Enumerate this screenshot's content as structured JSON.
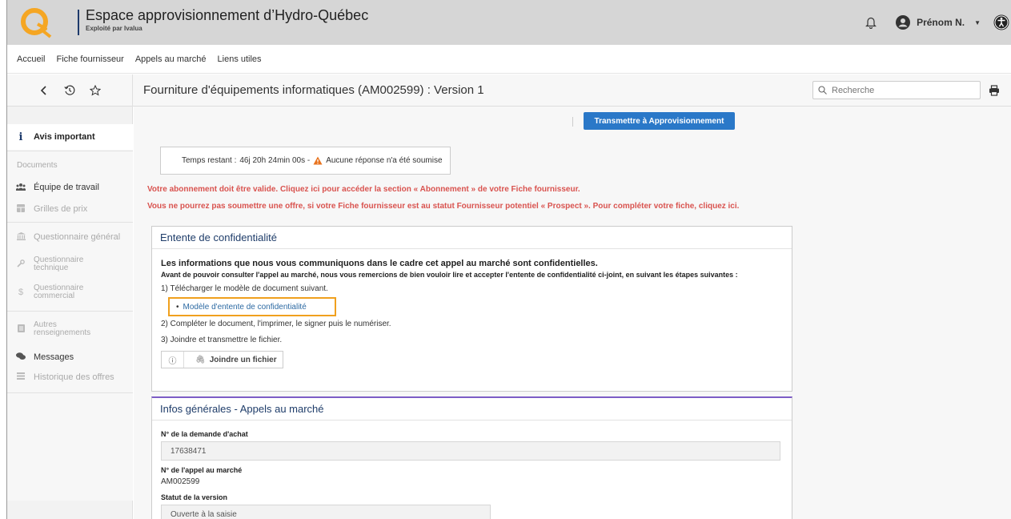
{
  "header": {
    "title": "Espace approvisionnement d’Hydro-Québec",
    "subtitle": "Exploité par Ivalua",
    "user_name": "Prénom N."
  },
  "menu": [
    "Accueil",
    "Fiche fournisseur",
    "Appels au marché",
    "Liens utiles"
  ],
  "titlebar": {
    "doc_title": "Fourniture d'équipements informatiques (AM002599) : Version 1",
    "search_placeholder": "Recherche"
  },
  "sidebar": {
    "active_item": "Avis important",
    "section_label": "Documents",
    "items": [
      {
        "label": "Équipe de travail",
        "icon": "team-icon",
        "enabled": true
      },
      {
        "label": "Grilles de prix",
        "icon": "grid-icon",
        "enabled": false
      },
      {
        "label": "Questionnaire général",
        "icon": "bank-icon",
        "enabled": false
      },
      {
        "label": "Questionnaire technique",
        "icon": "wrench-icon",
        "enabled": false
      },
      {
        "label": "Questionnaire commercial",
        "icon": "dollar-icon",
        "enabled": false
      },
      {
        "label": "Autres renseignements",
        "icon": "list-icon",
        "enabled": false
      },
      {
        "label": "Messages",
        "icon": "chat-icon",
        "enabled": true
      },
      {
        "label": "Historique des offres",
        "icon": "history-icon",
        "enabled": false
      }
    ]
  },
  "main": {
    "transmit_button": "Transmettre à Approvisionnement",
    "time_label": "Temps restant :",
    "time_value": "46j 20h 24min 00s -",
    "time_warning": "Aucune réponse n'a été soumise",
    "alert1": "Votre abonnement doit être valide. Cliquez ici pour accéder la section « Abonnement » de votre Fiche fournisseur.",
    "alert2": "Vous ne pourrez pas soumettre une offre, si votre Fiche fournisseur est au statut Fournisseur potentiel « Prospect ». Pour compléter votre fiche, cliquez ici.",
    "confidentiality": {
      "title": "Entente de confidentialité",
      "heading": "Les informations que nous vous communiquons dans le cadre cet appel au marché sont confidentielles.",
      "intro": "Avant de pouvoir consulter l'appel au marché, nous vous remercions de bien vouloir lire et accepter l'entente de confidentialité ci-joint, en suivant les étapes suivantes :",
      "step1": "1) Télécharger le modèle de document suivant.",
      "link": "Modèle d'entente de confidentialité",
      "step2": "2) Compléter le document, l'imprimer, le signer puis le numériser.",
      "step3": "3) Joindre et transmettre le fichier.",
      "attach_button": "Joindre un fichier"
    },
    "general_info": {
      "title": "Infos générales - Appels au marché",
      "purchase_request_label": "N° de la demande d'achat",
      "purchase_request_value": "17638471",
      "tender_number_label": "N° de l'appel au marché",
      "tender_number_value": "AM002599",
      "version_status_label": "Statut de la version",
      "version_status_value": "Ouverte à la saisie"
    }
  },
  "colors": {
    "primary_button": "#2a78c8",
    "alert_text": "#d9534f",
    "highlight_box": "#f0a01e",
    "panel_accent": "#7d5cc6",
    "logo_orange": "#f5a623"
  }
}
